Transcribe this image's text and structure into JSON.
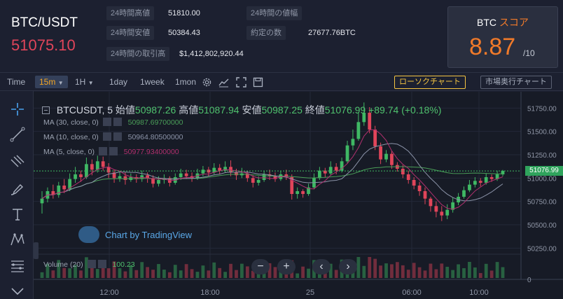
{
  "header": {
    "pair": "BTC/USDT",
    "last_price": "51075.10",
    "stats": [
      {
        "label": "24時間高値",
        "value": "51810.00"
      },
      {
        "label": "24時間の値幅",
        "value": ""
      },
      {
        "label": "24時間安値",
        "value": "50384.43"
      },
      {
        "label": "約定の数",
        "value": "27677.76BTC"
      },
      {
        "label": "24時間の取引高",
        "value": "$1,412,802,920.44"
      }
    ],
    "score": {
      "title_a": "BTC",
      "title_b": "スコア",
      "value": "8.87",
      "denominator": "/10"
    }
  },
  "toolbar": {
    "time_label": "Time",
    "intervals": [
      "15m",
      "1H",
      "1day",
      "1week",
      "1mon"
    ],
    "active_interval": "15m",
    "candle_button": "ローソクチャート",
    "depth_button": "市場奥行チャート"
  },
  "chart": {
    "symbol": "BTCUSDT, 5",
    "ohlc": {
      "open_label": "始値",
      "open": "50987.26",
      "high_label": "高値",
      "high": "51087.94",
      "low_label": "安値",
      "low": "50987.25",
      "close_label": "終値",
      "close": "51076.99",
      "change": "+89.74 (+0.18%)"
    },
    "indicators": [
      {
        "label": "MA (30, close, 0)",
        "value": "50987.69700000",
        "color": "#4a9e58"
      },
      {
        "label": "MA (10, close, 0)",
        "value": "50964.80500000",
        "color": "#8b93a8"
      },
      {
        "label": "MA (5, close, 0)",
        "value": "50977.93400000",
        "color": "#b0306e"
      }
    ],
    "volume": {
      "label": "Volume (20)",
      "value": "100.23"
    },
    "watermark": "Chart by TradingView",
    "current_price_label": "51076.99",
    "y_ticks": [
      "51750.00",
      "51500.00",
      "51250.00",
      "51000.00",
      "50750.00",
      "50500.00",
      "50250.00",
      "0"
    ],
    "x_ticks": [
      "12:00",
      "18:00",
      "25",
      "06:00",
      "10:00"
    ],
    "colors": {
      "up": "#3fb864",
      "down": "#e0455a",
      "ma30": "#4a9e58",
      "ma10": "#8b93a8",
      "ma5": "#b0306e"
    }
  },
  "chart_data": {
    "type": "candlestick",
    "title": "BTCUSDT, 5",
    "ylim": [
      50200,
      51850
    ],
    "current_price": 51076.99,
    "candles": [
      [
        50730,
        50780,
        50620,
        50860
      ],
      [
        50780,
        50860,
        50740,
        50900
      ],
      [
        50860,
        50820,
        50780,
        50930
      ],
      [
        50820,
        50920,
        50790,
        50960
      ],
      [
        50920,
        50880,
        50840,
        50990
      ],
      [
        50880,
        50990,
        50860,
        51050
      ],
      [
        50990,
        51040,
        50950,
        51120
      ],
      [
        51040,
        51010,
        50960,
        51080
      ],
      [
        51010,
        51150,
        50990,
        51220
      ],
      [
        51150,
        51090,
        51030,
        51200
      ],
      [
        51090,
        51180,
        51060,
        51240
      ],
      [
        51180,
        51120,
        51080,
        51230
      ],
      [
        51120,
        51060,
        51000,
        51160
      ],
      [
        51060,
        51000,
        50950,
        51090
      ],
      [
        51000,
        51020,
        50960,
        51070
      ],
      [
        51020,
        50980,
        50930,
        51060
      ],
      [
        50980,
        51010,
        50960,
        51050
      ],
      [
        51010,
        50990,
        50950,
        51040
      ],
      [
        50990,
        51030,
        50960,
        51080
      ],
      [
        51030,
        51000,
        50950,
        51060
      ],
      [
        51000,
        50940,
        50900,
        51030
      ],
      [
        50940,
        50980,
        50910,
        51020
      ],
      [
        50980,
        51000,
        50940,
        51040
      ],
      [
        51000,
        50950,
        50910,
        51020
      ],
      [
        50950,
        51010,
        50930,
        51050
      ],
      [
        51010,
        51050,
        50980,
        51100
      ],
      [
        51050,
        51020,
        50990,
        51090
      ],
      [
        51020,
        51000,
        50960,
        51060
      ],
      [
        51000,
        51050,
        50980,
        51100
      ],
      [
        51050,
        51090,
        51020,
        51130
      ],
      [
        51090,
        51060,
        51020,
        51120
      ],
      [
        51060,
        51110,
        51040,
        51160
      ],
      [
        51110,
        51080,
        51040,
        51150
      ],
      [
        51080,
        51120,
        51060,
        51180
      ],
      [
        51120,
        51060,
        51020,
        51190
      ],
      [
        51060,
        51030,
        50980,
        51100
      ],
      [
        51030,
        51050,
        51000,
        51110
      ],
      [
        51050,
        51000,
        50960,
        51080
      ],
      [
        51000,
        50950,
        50900,
        51030
      ],
      [
        50950,
        50980,
        50920,
        51020
      ],
      [
        50980,
        51040,
        50960,
        51080
      ],
      [
        51040,
        51020,
        50980,
        51090
      ],
      [
        51020,
        50990,
        50960,
        51060
      ],
      [
        50990,
        51040,
        50970,
        51080
      ],
      [
        51040,
        51010,
        50980,
        51090
      ],
      [
        51010,
        50830,
        50770,
        51040
      ],
      [
        50830,
        50860,
        50780,
        50900
      ],
      [
        50860,
        50830,
        50790,
        50880
      ],
      [
        50830,
        50900,
        50810,
        50940
      ],
      [
        50900,
        51000,
        50880,
        51050
      ],
      [
        51000,
        51080,
        50980,
        51120
      ],
      [
        51080,
        51050,
        51010,
        51110
      ],
      [
        51050,
        51120,
        51030,
        51180
      ],
      [
        51120,
        51080,
        51040,
        51160
      ],
      [
        51080,
        51180,
        51060,
        51220
      ],
      [
        51180,
        51350,
        51160,
        51400
      ],
      [
        51350,
        51420,
        51300,
        51520
      ],
      [
        51420,
        51600,
        51400,
        51700
      ],
      [
        51600,
        51700,
        51560,
        51810
      ],
      [
        51700,
        51520,
        51480,
        51760
      ],
      [
        51520,
        51340,
        51300,
        51560
      ],
      [
        51340,
        51200,
        51150,
        51380
      ],
      [
        51200,
        51260,
        51170,
        51300
      ],
      [
        51260,
        51140,
        51100,
        51290
      ],
      [
        51140,
        51100,
        51070,
        51170
      ],
      [
        51100,
        51040,
        51000,
        51140
      ],
      [
        51040,
        50980,
        50940,
        51080
      ],
      [
        50980,
        50920,
        50880,
        51010
      ],
      [
        50920,
        50860,
        50810,
        50960
      ],
      [
        50860,
        50780,
        50720,
        50900
      ],
      [
        50780,
        50700,
        50640,
        50800
      ],
      [
        50700,
        50640,
        50580,
        50750
      ],
      [
        50640,
        50600,
        50540,
        50700
      ],
      [
        50600,
        50660,
        50560,
        50720
      ],
      [
        50660,
        50740,
        50630,
        50790
      ],
      [
        50740,
        50800,
        50710,
        50840
      ],
      [
        50800,
        50870,
        50780,
        50910
      ],
      [
        50870,
        50930,
        50850,
        50980
      ],
      [
        50930,
        50970,
        50900,
        51010
      ],
      [
        50970,
        50950,
        50910,
        51000
      ],
      [
        50950,
        51010,
        50930,
        51050
      ],
      [
        51010,
        50990,
        50960,
        51040
      ],
      [
        50990,
        51040,
        50970,
        51080
      ],
      [
        51040,
        51077,
        51020,
        51088
      ]
    ]
  }
}
